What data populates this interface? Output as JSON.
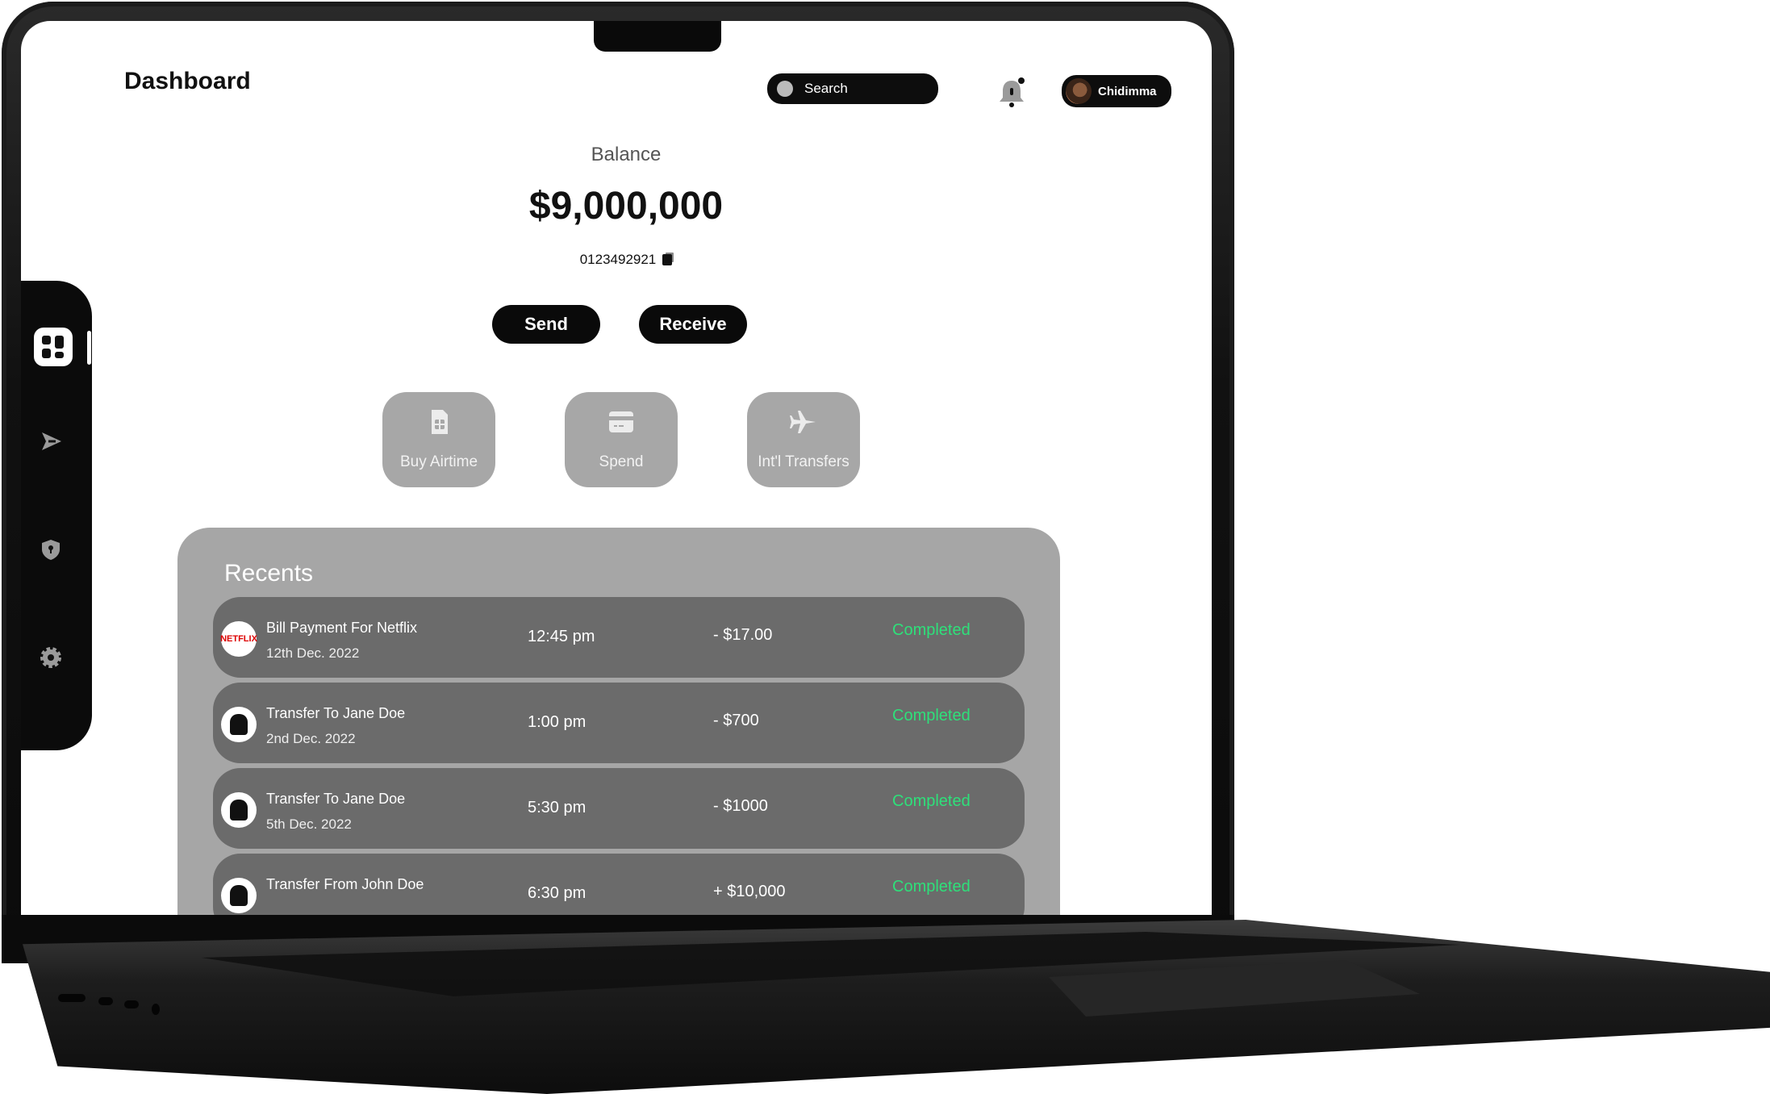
{
  "header": {
    "title": "Dashboard",
    "search_placeholder": "Search",
    "user_name": "Chidimma"
  },
  "balance": {
    "label": "Balance",
    "amount": "$9,000,000",
    "account_number": "0123492921"
  },
  "actions": {
    "send_label": "Send",
    "receive_label": "Receive"
  },
  "quick_actions": [
    {
      "label": "Buy Airtime",
      "icon": "sim-card-icon"
    },
    {
      "label": "Spend",
      "icon": "card-icon"
    },
    {
      "label": "Int'l Transfers",
      "icon": "airplane-icon"
    }
  ],
  "sidebar": {
    "items": [
      {
        "icon": "dashboard-icon",
        "active": true
      },
      {
        "icon": "send-icon"
      },
      {
        "icon": "shield-icon"
      },
      {
        "icon": "gear-icon"
      }
    ]
  },
  "recents": {
    "title": "Recents",
    "rows": [
      {
        "icon_text": "NETFLIX",
        "title": "Bill Payment For Netflix",
        "date": "12th Dec. 2022",
        "time": "12:45 pm",
        "amount": "- $17.00",
        "status": "Completed"
      },
      {
        "icon_text": "",
        "title": "Transfer To Jane Doe",
        "date": "2nd Dec. 2022",
        "time": "1:00 pm",
        "amount": "- $700",
        "status": "Completed"
      },
      {
        "icon_text": "",
        "title": "Transfer To Jane Doe",
        "date": "5th Dec. 2022",
        "time": "5:30 pm",
        "amount": "- $1000",
        "status": "Completed"
      },
      {
        "icon_text": "",
        "title": "Transfer From John Doe",
        "date": "",
        "time": "6:30 pm",
        "amount": "+ $10,000",
        "status": "Completed"
      }
    ]
  },
  "colors": {
    "status_completed": "#2ee07a",
    "card_gray": "#a6a6a6",
    "row_gray": "#6b6b6b"
  }
}
